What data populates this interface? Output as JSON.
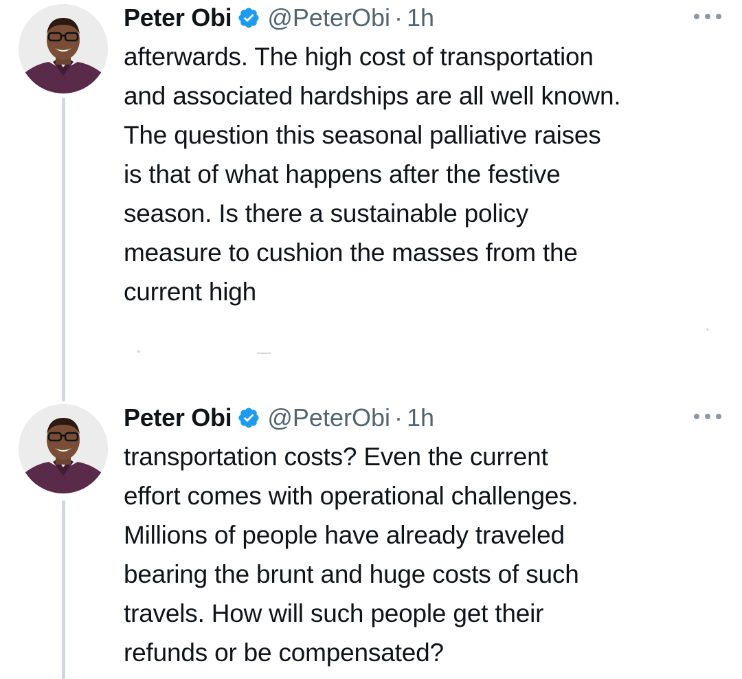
{
  "tweets": [
    {
      "author_name": "Peter Obi",
      "handle": "@PeterObi",
      "separator": "·",
      "time": "1h",
      "verified": true,
      "avatar_icon": "profile-photo",
      "lines": [
        "afterwards. The high cost of transportation",
        "and associated hardships are all well known.",
        "The question this seasonal palliative raises",
        "is that of what happens after the festive",
        "season. Is there a sustainable policy",
        "measure to cushion the masses from the",
        "current high"
      ]
    },
    {
      "author_name": "Peter Obi",
      "handle": "@PeterObi",
      "separator": "·",
      "time": "1h",
      "verified": true,
      "avatar_icon": "profile-photo",
      "lines": [
        "transportation costs? Even the current",
        "effort comes with operational challenges.",
        "Millions of people have already traveled",
        "bearing the brunt and huge costs of such",
        "travels. How will such people get their",
        "refunds or be compensated?"
      ]
    }
  ],
  "colors": {
    "text": "#0f1419",
    "secondary": "#536471",
    "verified_blue": "#1d9bf0",
    "thread_line": "#cfd9de"
  }
}
